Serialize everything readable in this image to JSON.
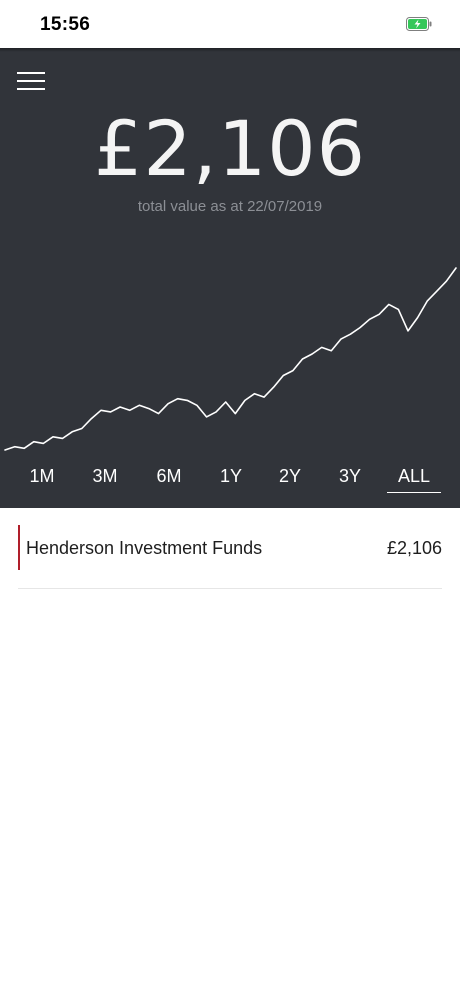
{
  "status_bar": {
    "time": "15:56",
    "battery_icon": "battery-charging-icon"
  },
  "header": {
    "menu_icon": "hamburger-menu-icon"
  },
  "summary": {
    "total_value": "£2,106",
    "caption": "total value as at 22/07/2019"
  },
  "chart_data": {
    "type": "line",
    "values": [
      1.0,
      1.02,
      1.01,
      1.05,
      1.04,
      1.08,
      1.07,
      1.11,
      1.13,
      1.19,
      1.24,
      1.23,
      1.26,
      1.24,
      1.27,
      1.25,
      1.22,
      1.28,
      1.31,
      1.3,
      1.27,
      1.2,
      1.23,
      1.29,
      1.22,
      1.3,
      1.34,
      1.32,
      1.38,
      1.45,
      1.48,
      1.55,
      1.58,
      1.62,
      1.6,
      1.67,
      1.7,
      1.74,
      1.79,
      1.82,
      1.88,
      1.85,
      1.72,
      1.8,
      1.9,
      1.96,
      2.02,
      2.1
    ],
    "color": "#ffffff"
  },
  "ranges": {
    "items": [
      "1M",
      "3M",
      "6M",
      "1Y",
      "2Y",
      "3Y",
      "ALL"
    ],
    "selected": "ALL"
  },
  "funds": [
    {
      "name": "Henderson Investment Funds",
      "value": "£2,106",
      "accent": "#b01e2a"
    }
  ]
}
